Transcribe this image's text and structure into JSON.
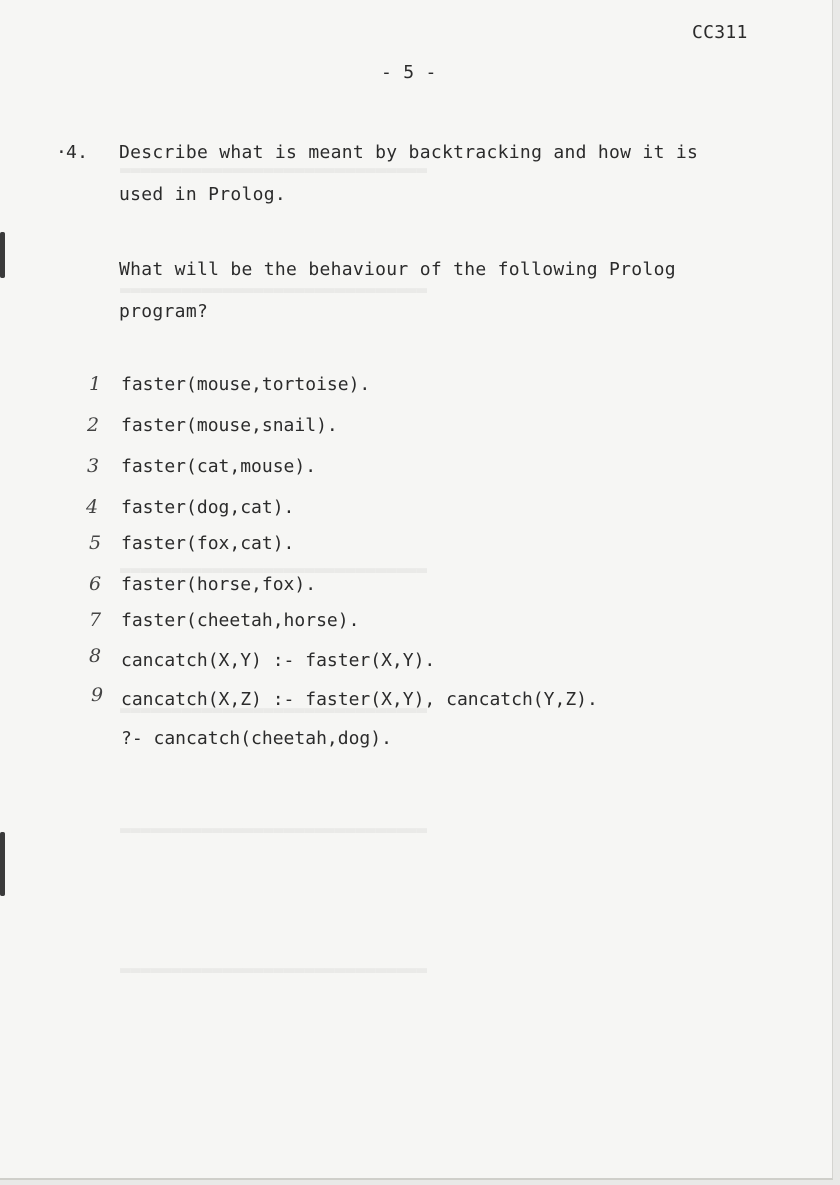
{
  "header": {
    "course_code": "CC311",
    "page_number": "- 5 -"
  },
  "question": {
    "bullet": "·",
    "number": "4.",
    "lines": [
      "Describe what is meant by backtracking and how it is",
      "used in Prolog."
    ],
    "followup": [
      "What will be the behaviour of the following Prolog",
      "program?"
    ]
  },
  "program": {
    "clauses": [
      {
        "note": "1",
        "text": "faster(mouse,tortoise)."
      },
      {
        "note": "2",
        "text": "faster(mouse,snail)."
      },
      {
        "note": "3",
        "text": "faster(cat,mouse)."
      },
      {
        "note": "4",
        "text": "faster(dog,cat)."
      },
      {
        "note": "5",
        "text": "faster(fox,cat)."
      },
      {
        "note": "6",
        "text": "faster(horse,fox)."
      },
      {
        "note": "7",
        "text": "faster(cheetah,horse)."
      },
      {
        "note": "8",
        "text": "cancatch(X,Y) :- faster(X,Y)."
      },
      {
        "note": "9",
        "text": "cancatch(X,Z) :- faster(X,Y), cancatch(Y,Z)."
      }
    ],
    "query": "?- cancatch(cheetah,dog)."
  }
}
